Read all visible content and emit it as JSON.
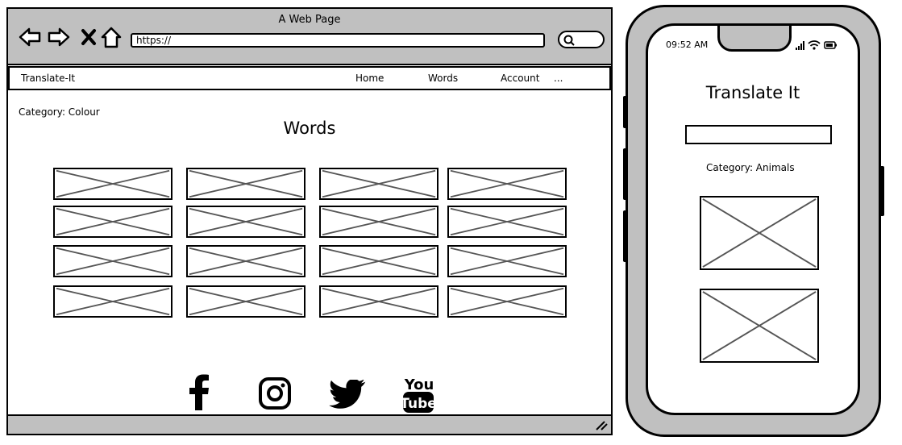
{
  "browser": {
    "title": "A Web Page",
    "url": "https://",
    "nav": {
      "brand": "Translate-It",
      "items": [
        "Home",
        "Words",
        "Account",
        "..."
      ]
    },
    "category": "Category: Colour",
    "heading": "Words",
    "social_icons": [
      "facebook-icon",
      "instagram-icon",
      "twitter-icon",
      "youtube-icon"
    ],
    "youtube_text_top": "You",
    "youtube_text_bottom": "Tube"
  },
  "phone": {
    "time": "09:52 AM",
    "title": "Translate It",
    "search_value": "",
    "category": "Category: Animals"
  },
  "colors": {
    "chrome": "#c0c0c0",
    "placeholder_cross": "#555555",
    "outline": "#000000"
  }
}
